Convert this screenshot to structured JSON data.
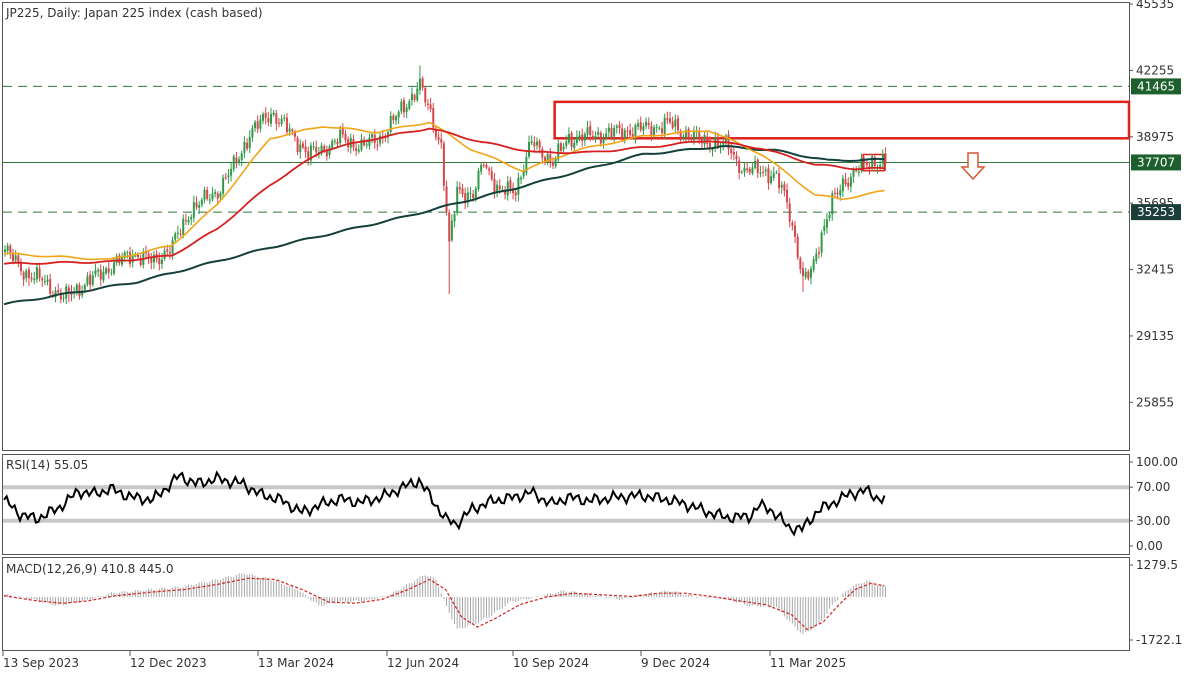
{
  "title": "JP225, Daily:  Japan 225 index (cash based)",
  "colors": {
    "bull": "#2f9a48",
    "bear": "#d8454a",
    "ma_fast": "#f2a516",
    "ma_mid": "#d62020",
    "ma_slow": "#15403a",
    "zone": "#e0211c",
    "level_line": "#2f7a3c",
    "tag_bg": "#1e5f2e",
    "tag_bg_dark": "#1c3e3a",
    "rsi": "#000000",
    "rsi_levels": "#c8c8c8",
    "macd_hist": "#a8a8a8",
    "macd_signal": "#d62020",
    "arrow": "#d9572a"
  },
  "chart_data": [
    {
      "type": "candlestick",
      "title": "JP225, Daily:  Japan 225 index (cash based)",
      "ylim": [
        23500,
        45535
      ],
      "y_ticks": [
        "45535",
        "42255",
        "38975",
        "35695",
        "32415",
        "29135",
        "25855"
      ],
      "x_ticks": [
        "13 Sep 2023",
        "12 Dec 2023",
        "13 Mar 2024",
        "12 Jun 2024",
        "10 Sep 2024",
        "9 Dec 2024",
        "11 Mar 2025"
      ],
      "price_path": [
        [
          0,
          33400
        ],
        [
          8,
          32200
        ],
        [
          14,
          31900
        ],
        [
          22,
          31000
        ],
        [
          30,
          31700
        ],
        [
          40,
          32600
        ],
        [
          48,
          33200
        ],
        [
          56,
          32800
        ],
        [
          63,
          33600
        ],
        [
          70,
          35400
        ],
        [
          80,
          36300
        ],
        [
          86,
          37500
        ],
        [
          92,
          39100
        ],
        [
          100,
          40200
        ],
        [
          108,
          39100
        ],
        [
          114,
          38100
        ],
        [
          120,
          38400
        ],
        [
          126,
          38900
        ],
        [
          134,
          38500
        ],
        [
          142,
          39000
        ],
        [
          150,
          40500
        ],
        [
          156,
          41500
        ],
        [
          160,
          40100
        ],
        [
          164,
          38500
        ],
        [
          167,
          33500
        ],
        [
          170,
          36400
        ],
        [
          176,
          36000
        ],
        [
          180,
          37800
        ],
        [
          186,
          36200
        ],
        [
          192,
          36400
        ],
        [
          198,
          38700
        ],
        [
          206,
          37700
        ],
        [
          212,
          38900
        ],
        [
          220,
          39000
        ],
        [
          230,
          39200
        ],
        [
          240,
          39400
        ],
        [
          250,
          39600
        ],
        [
          258,
          39000
        ],
        [
          265,
          38700
        ],
        [
          272,
          38500
        ],
        [
          278,
          37200
        ],
        [
          284,
          37400
        ],
        [
          290,
          36900
        ],
        [
          294,
          35800
        ],
        [
          297,
          34000
        ],
        [
          300,
          31800
        ],
        [
          303,
          32300
        ],
        [
          307,
          34200
        ],
        [
          311,
          35700
        ],
        [
          315,
          36700
        ],
        [
          320,
          37300
        ],
        [
          326,
          37800
        ],
        [
          331,
          37700
        ]
      ],
      "spikes": [
        {
          "i": 9,
          "low": 31600
        },
        {
          "i": 24,
          "low": 30800
        },
        {
          "i": 167,
          "low": 31200
        },
        {
          "i": 300,
          "low": 31300
        },
        {
          "i": 156,
          "high": 42500
        }
      ],
      "ma_fast_path": [
        [
          0,
          33200
        ],
        [
          40,
          32900
        ],
        [
          63,
          33600
        ],
        [
          80,
          35600
        ],
        [
          100,
          38900
        ],
        [
          120,
          39500
        ],
        [
          140,
          39200
        ],
        [
          160,
          39700
        ],
        [
          175,
          38400
        ],
        [
          195,
          37300
        ],
        [
          215,
          38300
        ],
        [
          240,
          39000
        ],
        [
          265,
          39300
        ],
        [
          285,
          38100
        ],
        [
          305,
          36100
        ],
        [
          315,
          35900
        ],
        [
          331,
          36300
        ]
      ],
      "ma_mid_path": [
        [
          0,
          32700
        ],
        [
          40,
          32800
        ],
        [
          63,
          33100
        ],
        [
          80,
          34400
        ],
        [
          100,
          36600
        ],
        [
          120,
          38300
        ],
        [
          140,
          38900
        ],
        [
          160,
          39400
        ],
        [
          180,
          38700
        ],
        [
          200,
          38200
        ],
        [
          220,
          38200
        ],
        [
          245,
          38500
        ],
        [
          265,
          38800
        ],
        [
          285,
          38400
        ],
        [
          305,
          37600
        ],
        [
          320,
          37400
        ],
        [
          331,
          37400
        ]
      ],
      "ma_slow_path": [
        [
          0,
          30700
        ],
        [
          50,
          31800
        ],
        [
          100,
          33500
        ],
        [
          150,
          35000
        ],
        [
          200,
          36700
        ],
        [
          240,
          38100
        ],
        [
          270,
          38500
        ],
        [
          290,
          38300
        ],
        [
          310,
          37800
        ],
        [
          331,
          37850
        ]
      ],
      "levels": [
        {
          "value": 41465,
          "label": "41465",
          "style": "dashed"
        },
        {
          "value": 37707,
          "label": "37707",
          "style": "solid"
        },
        {
          "value": 35253,
          "label": "35253",
          "style": "dashed"
        }
      ],
      "resistance_zone": {
        "from_i": 207,
        "y_low": 38900,
        "y_high": 40700
      },
      "recent_zone": {
        "from_i": 323,
        "to_i": 331,
        "y_low": 37300,
        "y_high": 38100
      },
      "outlook": "down"
    },
    {
      "type": "line",
      "title": "RSI(14) 55.05",
      "ylim": [
        0,
        100
      ],
      "y_ticks": [
        "100.00",
        "70.00",
        "30.00",
        "0.00"
      ],
      "levels": [
        70,
        30
      ],
      "path": [
        [
          0,
          55
        ],
        [
          6,
          38
        ],
        [
          12,
          32
        ],
        [
          20,
          44
        ],
        [
          28,
          65
        ],
        [
          34,
          62
        ],
        [
          40,
          68
        ],
        [
          48,
          58
        ],
        [
          56,
          55
        ],
        [
          62,
          72
        ],
        [
          66,
          84
        ],
        [
          72,
          74
        ],
        [
          80,
          80
        ],
        [
          90,
          74
        ],
        [
          96,
          62
        ],
        [
          104,
          55
        ],
        [
          112,
          40
        ],
        [
          118,
          48
        ],
        [
          126,
          56
        ],
        [
          134,
          52
        ],
        [
          142,
          58
        ],
        [
          150,
          70
        ],
        [
          156,
          78
        ],
        [
          160,
          60
        ],
        [
          166,
          32
        ],
        [
          170,
          26
        ],
        [
          176,
          44
        ],
        [
          184,
          54
        ],
        [
          192,
          58
        ],
        [
          198,
          64
        ],
        [
          206,
          50
        ],
        [
          212,
          58
        ],
        [
          220,
          54
        ],
        [
          230,
          58
        ],
        [
          240,
          60
        ],
        [
          250,
          55
        ],
        [
          258,
          48
        ],
        [
          265,
          40
        ],
        [
          272,
          34
        ],
        [
          280,
          35
        ],
        [
          284,
          48
        ],
        [
          288,
          44
        ],
        [
          292,
          32
        ],
        [
          295,
          22
        ],
        [
          300,
          20
        ],
        [
          306,
          42
        ],
        [
          312,
          52
        ],
        [
          318,
          62
        ],
        [
          324,
          66
        ],
        [
          328,
          58
        ],
        [
          331,
          55
        ]
      ]
    },
    {
      "type": "bar",
      "title": "MACD(12,26,9) 410.8 445.0",
      "ylim": [
        -1722.1,
        1279.5
      ],
      "y_ticks": [
        "1279.5",
        "-1722.1"
      ],
      "hist_path": [
        [
          0,
          100
        ],
        [
          10,
          -100
        ],
        [
          20,
          -350
        ],
        [
          30,
          -150
        ],
        [
          40,
          150
        ],
        [
          55,
          300
        ],
        [
          66,
          400
        ],
        [
          80,
          700
        ],
        [
          90,
          950
        ],
        [
          100,
          700
        ],
        [
          110,
          300
        ],
        [
          118,
          -350
        ],
        [
          126,
          -200
        ],
        [
          136,
          -150
        ],
        [
          145,
          100
        ],
        [
          153,
          600
        ],
        [
          158,
          900
        ],
        [
          162,
          700
        ],
        [
          166,
          -400
        ],
        [
          170,
          -1300
        ],
        [
          176,
          -1100
        ],
        [
          182,
          -800
        ],
        [
          190,
          -200
        ],
        [
          200,
          0
        ],
        [
          210,
          250
        ],
        [
          220,
          100
        ],
        [
          232,
          -100
        ],
        [
          240,
          100
        ],
        [
          250,
          250
        ],
        [
          260,
          0
        ],
        [
          270,
          -50
        ],
        [
          280,
          -350
        ],
        [
          290,
          -400
        ],
        [
          296,
          -1100
        ],
        [
          300,
          -1500
        ],
        [
          306,
          -1100
        ],
        [
          312,
          -200
        ],
        [
          318,
          400
        ],
        [
          324,
          650
        ],
        [
          328,
          500
        ],
        [
          331,
          410
        ]
      ],
      "signal_path": [
        [
          0,
          50
        ],
        [
          12,
          -150
        ],
        [
          22,
          -250
        ],
        [
          32,
          -150
        ],
        [
          42,
          50
        ],
        [
          56,
          200
        ],
        [
          68,
          300
        ],
        [
          80,
          500
        ],
        [
          92,
          750
        ],
        [
          102,
          700
        ],
        [
          112,
          300
        ],
        [
          122,
          -200
        ],
        [
          132,
          -250
        ],
        [
          142,
          -100
        ],
        [
          152,
          300
        ],
        [
          160,
          700
        ],
        [
          166,
          300
        ],
        [
          172,
          -800
        ],
        [
          178,
          -1200
        ],
        [
          184,
          -900
        ],
        [
          194,
          -300
        ],
        [
          204,
          0
        ],
        [
          214,
          150
        ],
        [
          226,
          80
        ],
        [
          236,
          20
        ],
        [
          246,
          150
        ],
        [
          256,
          150
        ],
        [
          266,
          20
        ],
        [
          276,
          -150
        ],
        [
          286,
          -300
        ],
        [
          296,
          -700
        ],
        [
          302,
          -1300
        ],
        [
          308,
          -1000
        ],
        [
          314,
          -300
        ],
        [
          320,
          300
        ],
        [
          326,
          550
        ],
        [
          331,
          445
        ]
      ]
    }
  ]
}
